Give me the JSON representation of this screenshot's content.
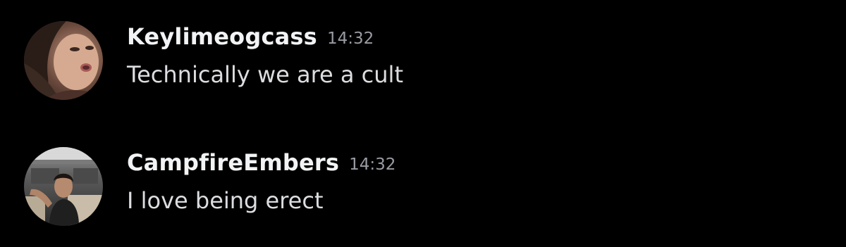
{
  "messages": [
    {
      "username": "Keylimeogcass",
      "timestamp": "14:32",
      "content": "Technically we are a cult",
      "avatar_icon": "user-avatar-photo"
    },
    {
      "username": "CampfireEmbers",
      "timestamp": "14:32",
      "content": "I love being erect",
      "avatar_icon": "user-avatar-photo"
    }
  ],
  "colors": {
    "background": "#000000",
    "username": "#f2f3f5",
    "timestamp": "#9a9ca3",
    "message_text": "#dcdde0"
  }
}
